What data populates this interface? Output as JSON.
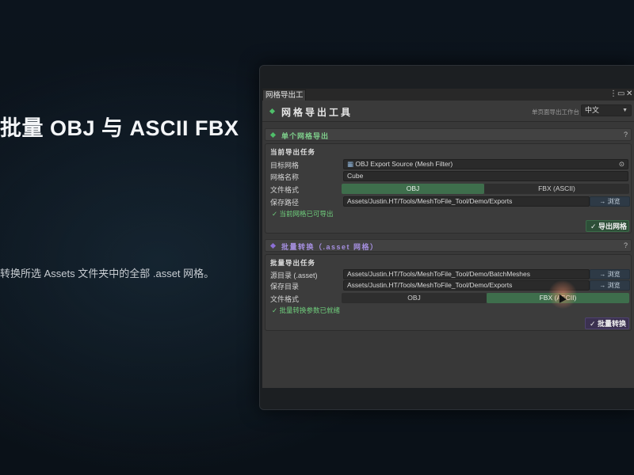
{
  "slide": {
    "title": "批量 OBJ 与 ASCII FBX",
    "description": "转换所选 Assets 文件夹中的全部 .asset 网格。"
  },
  "editor": {
    "tab_label": "网格导出工具",
    "header": {
      "title": "网格导出工具",
      "subtitle": "单页面导出工作台",
      "language": "中文"
    },
    "single_section": {
      "title": "单个网格导出",
      "help": "?",
      "panel_title": "当前导出任务",
      "target_label": "目标网格",
      "target_value": "OBJ Export Source (Mesh Filter)",
      "name_label": "网格名称",
      "name_value": "Cube",
      "format_label": "文件格式",
      "format_options": [
        "OBJ",
        "FBX (ASCII)"
      ],
      "selected_format": "OBJ",
      "path_label": "保存路径",
      "path_value": "Assets/Justin.HT/Tools/MeshToFile_Tool/Demo/Exports",
      "browse_label": "→ 浏览",
      "status": "✓ 当前网格已可导出",
      "action_label": "✓ 导出网格"
    },
    "batch_section": {
      "title": "批量转换（.asset 网格）",
      "help": "?",
      "panel_title": "批量导出任务",
      "source_label": "源目录 (.asset)",
      "source_value": "Assets/Justin.HT/Tools/MeshToFile_Tool/Demo/BatchMeshes",
      "save_label": "保存目录",
      "save_value": "Assets/Justin.HT/Tools/MeshToFile_Tool/Demo/Exports",
      "browse_label": "→ 浏览",
      "format_label": "文件格式",
      "format_options": [
        "OBJ",
        "FBX (ASCII)"
      ],
      "selected_format": "FBX (ASCII)",
      "status": "✓ 批量转换参数已就绪",
      "action_label": "✓ 批量转换"
    }
  },
  "colors": {
    "accent_green": "#3e6e4c",
    "status_green": "#6fce7c",
    "batch_purple": "#8c6fd6"
  },
  "icons": {
    "target_field": "mesh-filter-icon",
    "picker": "object-picker-icon",
    "window_menu": "kebab-menu-icon",
    "window_max": "maximize-icon",
    "window_close": "close-icon"
  }
}
